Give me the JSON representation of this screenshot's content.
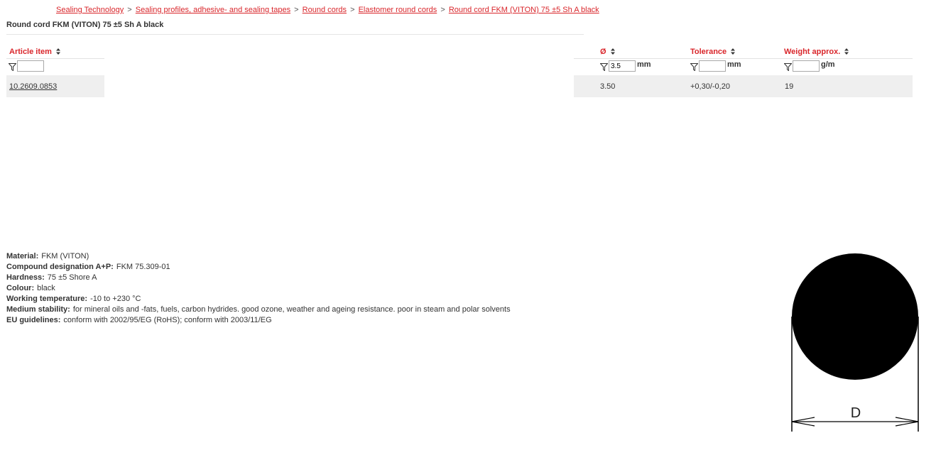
{
  "breadcrumb": {
    "items": [
      "Sealing Technology",
      "Sealing profiles, adhesive- and sealing tapes",
      "Round cords",
      "Elastomer round cords",
      "Round cord FKM (VITON) 75 ±5 Sh A black"
    ],
    "separator": ">"
  },
  "page_title": "Round cord FKM (VITON) 75 ±5 Sh A black",
  "table": {
    "columns": {
      "article": {
        "label": "Article item",
        "filter_value": "",
        "unit": ""
      },
      "diameter": {
        "label": "Ø",
        "filter_value": "3.5",
        "unit": "mm"
      },
      "tolerance": {
        "label": "Tolerance",
        "filter_value": "",
        "unit": "mm"
      },
      "weight": {
        "label": "Weight approx.",
        "filter_value": "",
        "unit": "g/m"
      }
    },
    "rows": [
      {
        "article": "10.2609.0853",
        "diameter": "3.50",
        "tolerance": "+0,30/-0,20",
        "weight": "19"
      }
    ]
  },
  "properties": [
    {
      "label": "Material:",
      "value": "FKM (VITON)"
    },
    {
      "label": "Compound designation A+P:",
      "value": "FKM 75.309-01"
    },
    {
      "label": "Hardness:",
      "value": "75 ±5 Shore A"
    },
    {
      "label": "Colour:",
      "value": "black"
    },
    {
      "label": "Working temperature:",
      "value": "-10 to +230 °C"
    },
    {
      "label": "Medium stability:",
      "value": "for mineral oils and -fats, fuels, carbon hydrides. good ozone, weather and ageing resistance. poor in steam and polar solvents"
    },
    {
      "label": "EU guidelines:",
      "value": "conform with 2002/95/EG (RoHS); conform with 2003/11/EG"
    }
  ],
  "drawing": {
    "dimension_label": "D"
  },
  "colors": {
    "accent": "#d9262b",
    "row_bg": "#efefef"
  }
}
